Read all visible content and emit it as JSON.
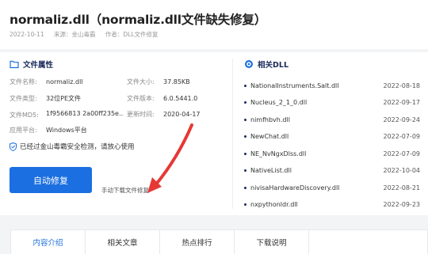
{
  "header": {
    "title": "normaliz.dll（normaliz.dll文件缺失修复）",
    "date": "2022-10-11",
    "source": "来源：金山毒霸",
    "author": "作者：DLL文件修复"
  },
  "file_attrs": {
    "heading": "文件属性",
    "name_label": "文件名称:",
    "name_value": "normaliz.dll",
    "size_label": "文件大小:",
    "size_value": "37.85KB",
    "type_label": "文件类型:",
    "type_value": "32位PE文件",
    "version_label": "文件版本:",
    "version_value": "6.0.5441.0",
    "md5_label": "文件MD5:",
    "md5_value": "1f9566813 2a00ff235e...",
    "time_label": "更新时间:",
    "time_value": "2020-04-17",
    "platform_label": "应用平台:",
    "platform_value": "Windows平台"
  },
  "notice": "已经过金山毒霸安全检测，请放心使用",
  "fix_button": "自动修复",
  "manual_link": "手动下载文件修复",
  "related": {
    "heading": "相关DLL",
    "items": [
      {
        "name": "NationalInstruments.Salt.dll",
        "date": "2022-08-18"
      },
      {
        "name": "Nucleus_2_1_0.dll",
        "date": "2022-09-17"
      },
      {
        "name": "nimfhbvh.dll",
        "date": "2022-09-24"
      },
      {
        "name": "NewChat.dll",
        "date": "2022-07-09"
      },
      {
        "name": "NE_NvNgxDlss.dll",
        "date": "2022-07-09"
      },
      {
        "name": "NativeList.dll",
        "date": "2022-10-04"
      },
      {
        "name": "nivisaHardwareDiscovery.dll",
        "date": "2022-08-21"
      },
      {
        "name": "nxpythonldr.dll",
        "date": "2022-09-23"
      }
    ]
  },
  "tabs": [
    "内容介绍",
    "相关文章",
    "热点排行",
    "下载说明"
  ],
  "colors": {
    "accent": "#1b6fe0",
    "heading": "#1a2b5c",
    "arrow": "#e53935"
  },
  "icons": {
    "file_attrs": "folder-icon",
    "related": "target-icon",
    "notice": "shield-icon"
  }
}
